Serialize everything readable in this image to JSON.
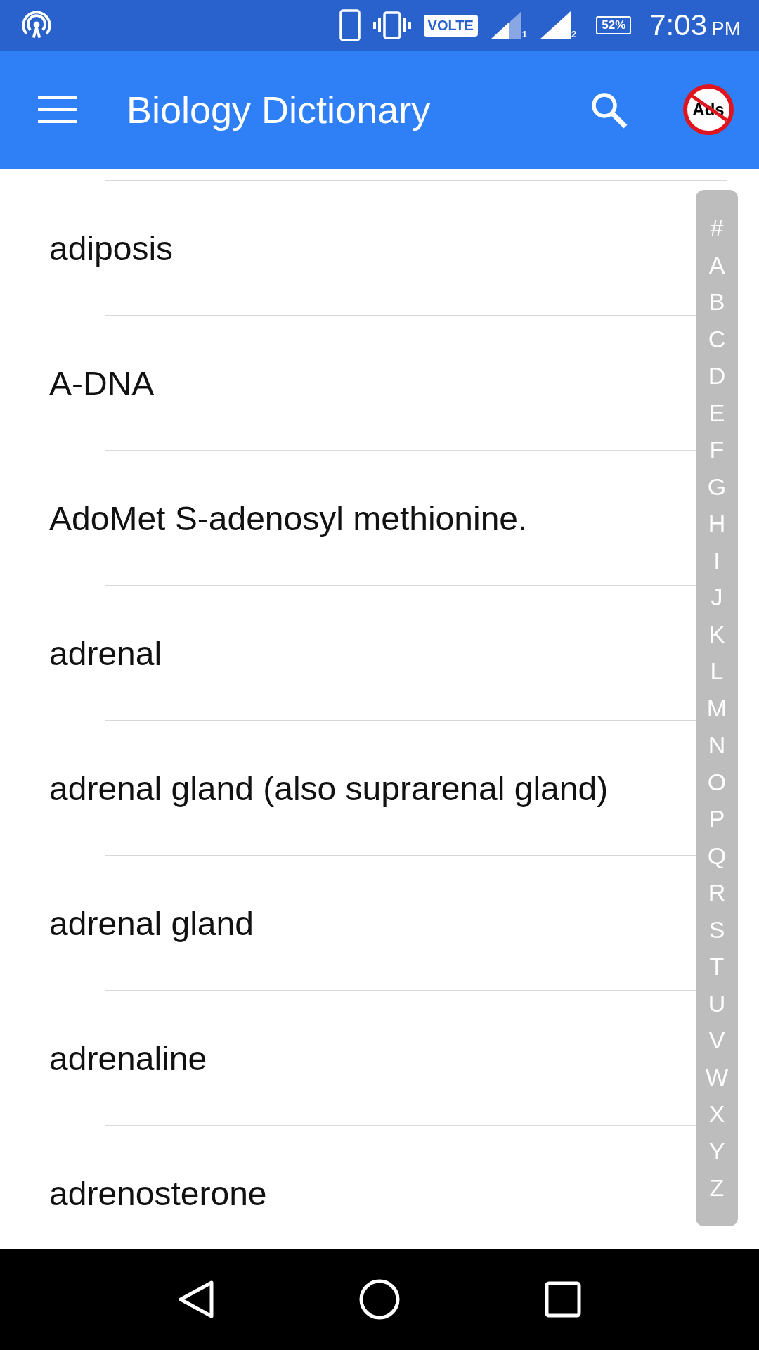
{
  "status_bar": {
    "network_badge": "VOLTE",
    "sim_labels": [
      "1",
      "2"
    ],
    "battery": "52%",
    "time": "7:03",
    "meridiem": "PM"
  },
  "app_bar": {
    "title": "Biology Dictionary",
    "no_ads_label": "Ads"
  },
  "terms": [
    "adiposis",
    "A-DNA",
    "AdoMet S-adenosyl methionine.",
    "adrenal",
    "adrenal gland (also suprarenal gland)",
    "adrenal gland",
    "adrenaline",
    "adrenosterone"
  ],
  "index": [
    "#",
    "A",
    "B",
    "C",
    "D",
    "E",
    "F",
    "G",
    "H",
    "I",
    "J",
    "K",
    "L",
    "M",
    "N",
    "O",
    "P",
    "Q",
    "R",
    "S",
    "T",
    "U",
    "V",
    "W",
    "X",
    "Y",
    "Z"
  ]
}
